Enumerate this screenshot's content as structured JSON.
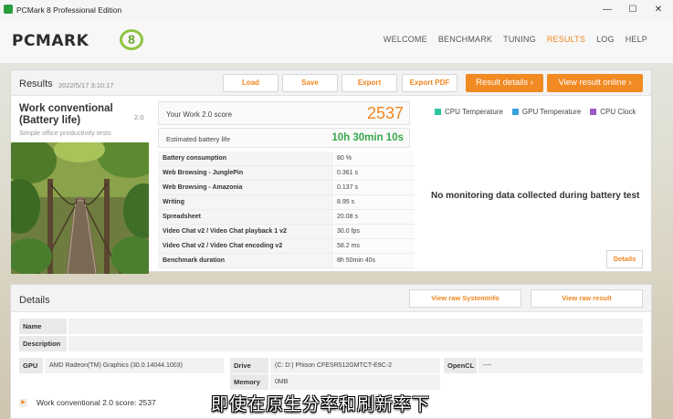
{
  "window": {
    "title": "PCMark 8 Professional Edition",
    "minimize": "—",
    "maximize": "☐",
    "close": "✕"
  },
  "header": {
    "logo_text": "PCMARK",
    "logo_badge": "8",
    "nav": [
      "WELCOME",
      "BENCHMARK",
      "TUNING",
      "RESULTS",
      "LOG",
      "HELP"
    ],
    "active_nav": "RESULTS"
  },
  "results": {
    "title": "Results",
    "date": "2022/5/17 3:10:17",
    "buttons": {
      "load": "Load",
      "save": "Save",
      "export": "Export",
      "export_pdf": "Export PDF",
      "result_details": "Result details",
      "view_online": "View result online"
    },
    "test": {
      "name": "Work conventional (Battery life)",
      "version": "2.0",
      "description": "Simple office productivity tests"
    },
    "score": {
      "label": "Your Work 2.0 score",
      "value": "2537"
    },
    "battery": {
      "label": "Estimated battery life",
      "value": "10h 30min 10s"
    },
    "subscores": [
      {
        "name": "Battery consumption",
        "value": "80 %"
      },
      {
        "name": "Web Browsing - JunglePin",
        "value": "0.361 s"
      },
      {
        "name": "Web Browsing - Amazonia",
        "value": "0.137 s"
      },
      {
        "name": "Writing",
        "value": "8.95 s"
      },
      {
        "name": "Spreadsheet",
        "value": "20.08 s"
      },
      {
        "name": "Video Chat v2 / Video Chat playback 1 v2",
        "value": "30.0 fps"
      },
      {
        "name": "Video Chat v2 / Video Chat encoding v2",
        "value": "58.2 ms"
      },
      {
        "name": "Benchmark duration",
        "value": "8h 50min 40s"
      }
    ],
    "monitoring": {
      "legend": [
        {
          "label": "CPU Temperature",
          "color": "#2ec4a0"
        },
        {
          "label": "GPU Temperature",
          "color": "#3aa0e0"
        },
        {
          "label": "CPU Clock",
          "color": "#9b59c6"
        }
      ],
      "no_data": "No monitoring data collected during battery test",
      "details_button": "Details"
    }
  },
  "details": {
    "title": "Details",
    "view_sysinfo": "View raw SystemInfo",
    "view_result": "View raw result",
    "name_label": "Name",
    "name_value": "",
    "description_label": "Description",
    "description_value": "",
    "gpu_label": "GPU",
    "gpu_value": "AMD Radeon(TM) Graphics (30.0.14044.1003)",
    "drive_label": "Drive",
    "drive_value": "(C: D:) Phison CFESR512GMTCT-E9C-2",
    "memory_label": "Memory",
    "memory_value": "0MB",
    "opencl_label": "OpenCL",
    "opencl_value": "----",
    "expand_text": "Work conventional 2.0 score: 2537"
  },
  "subtitle": "即使在原生分率和刷新率下"
}
